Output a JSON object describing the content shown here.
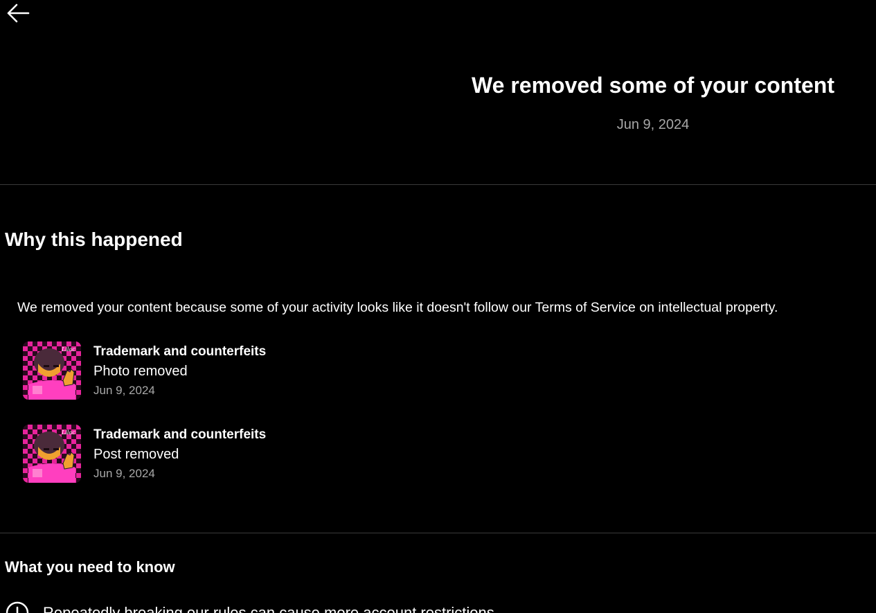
{
  "header": {
    "back_icon": "arrow-left-icon",
    "title": "We removed some of your content",
    "date": "Jun 9, 2024"
  },
  "why_section": {
    "heading": "Why this happened",
    "reason": "We removed your content because some of your activity looks like it doesn't follow our Terms of Service on intellectual property.",
    "items": [
      {
        "policy": "Trademark and counterfeits",
        "action": "Photo removed",
        "date": "Jun 9, 2024"
      },
      {
        "policy": "Trademark and counterfeits",
        "action": "Post removed",
        "date": "Jun 9, 2024"
      }
    ]
  },
  "need_section": {
    "heading": "What you need to know",
    "items": [
      {
        "icon": "alert-circle-icon",
        "text": "Repeatedly breaking our rules can cause more account restrictions"
      }
    ]
  },
  "colors": {
    "background": "#000000",
    "text_primary": "#ffffff",
    "text_secondary": "#a8a8a8",
    "divider": "#3a3a3a",
    "thumbnail_pink": "#e8239c"
  }
}
